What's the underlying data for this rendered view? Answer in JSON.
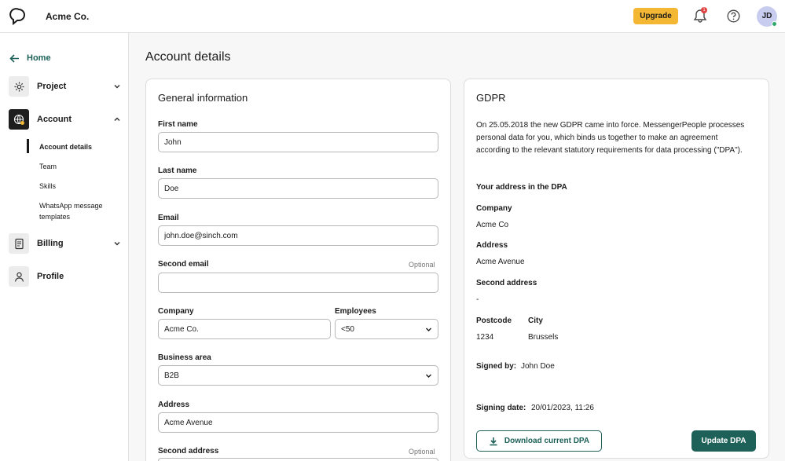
{
  "header": {
    "company": "Acme Co.",
    "upgrade_label": "Upgrade",
    "notification_count": "1",
    "avatar_initials": "JD"
  },
  "sidebar": {
    "home_label": "Home",
    "items": [
      {
        "label": "Project",
        "icon": "gear-icon",
        "expanded": false
      },
      {
        "label": "Account",
        "icon": "globe-icon",
        "expanded": true
      },
      {
        "label": "Billing",
        "icon": "invoice-icon",
        "expanded": false
      },
      {
        "label": "Profile",
        "icon": "user-icon",
        "expanded": false
      }
    ],
    "account_sub": [
      "Account details",
      "Team",
      "Skills",
      "WhatsApp message templates"
    ]
  },
  "page": {
    "title": "Account details"
  },
  "general": {
    "title": "General information",
    "optional_label": "Optional",
    "first_name_label": "First name",
    "first_name": "John",
    "last_name_label": "Last name",
    "last_name": "Doe",
    "email_label": "Email",
    "email": "john.doe@sinch.com",
    "second_email_label": "Second email",
    "second_email": "",
    "company_label": "Company",
    "company": "Acme Co.",
    "employees_label": "Employees",
    "employees": "<50",
    "business_area_label": "Business area",
    "business_area": "B2B",
    "address_label": "Address",
    "address": "Acme Avenue",
    "second_address_label": "Second address"
  },
  "gdpr": {
    "title": "GDPR",
    "intro": "On 25.05.2018 the new GDPR came into force. MessengerPeople processes personal data for you, which binds us together to make an agreement according to the relevant statutory requirements for data processing (\"DPA\").",
    "address_heading": "Your address in the DPA",
    "company_label": "Company",
    "company": "Acme Co",
    "address_label": "Address",
    "address": "Acme Avenue",
    "second_address_label": "Second address",
    "second_address": "-",
    "postcode_label": "Postcode",
    "postcode": "1234",
    "city_label": "City",
    "city": "Brussels",
    "signed_by_label": "Signed by:",
    "signed_by": "John Doe",
    "signing_date_label": "Signing date:",
    "signing_date": "20/01/2023, 11:26",
    "download_label": "Download current DPA",
    "update_label": "Update DPA"
  },
  "colors": {
    "accent": "#1d6159",
    "upgrade": "#f4b733",
    "badge": "#e0403f",
    "online": "#2ea86b"
  }
}
